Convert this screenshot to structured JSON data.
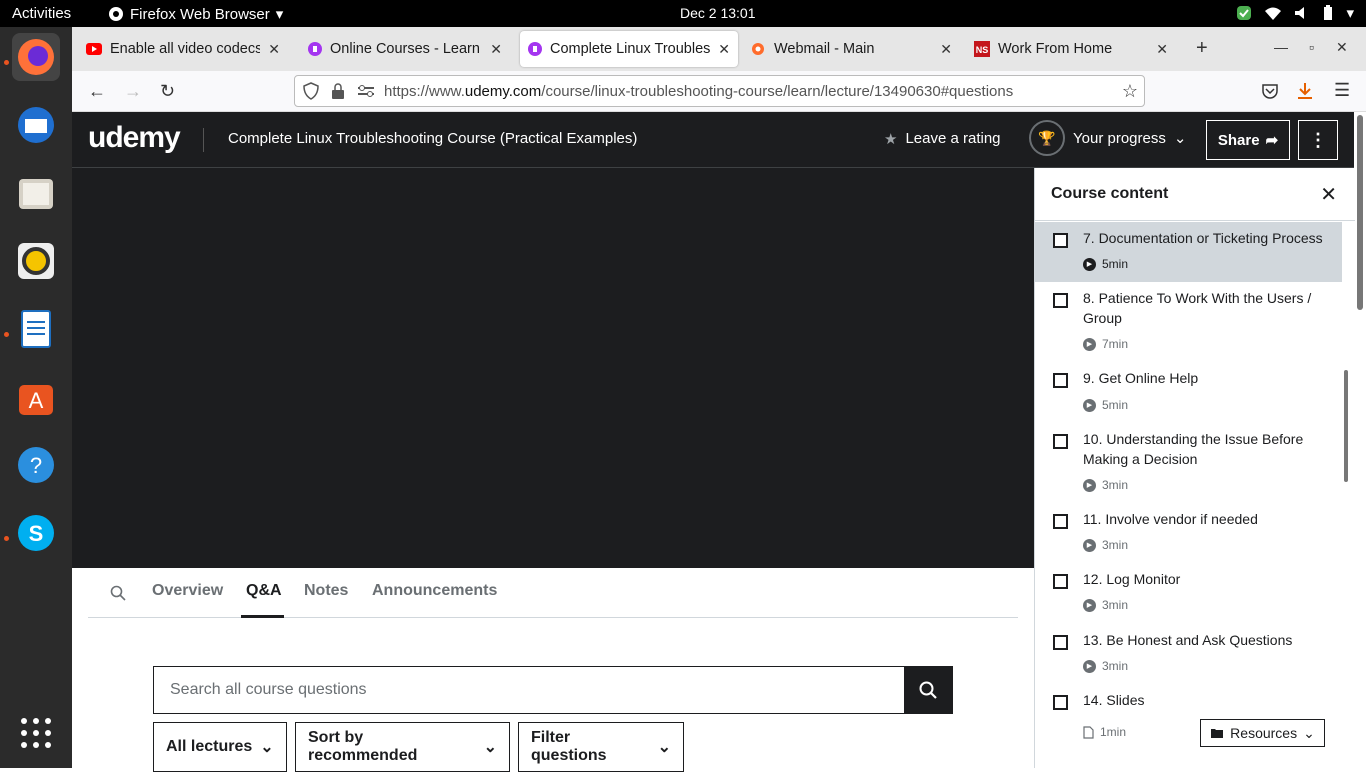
{
  "system": {
    "activities": "Activities",
    "app_name": "Firefox Web Browser",
    "clock": "Dec 2  13:01"
  },
  "tabs": [
    {
      "title": "Enable all video codecs o",
      "icon": "youtube-icon",
      "color": "#ff0000"
    },
    {
      "title": "Online Courses - Learn An",
      "icon": "udemy-icon",
      "color": "#a435f0"
    },
    {
      "title": "Complete Linux Troubleshoo",
      "icon": "udemy-icon",
      "color": "#a435f0"
    },
    {
      "title": "Webmail - Main",
      "icon": "cpanel-icon",
      "color": "#ff6c2c"
    },
    {
      "title": "Work From Home",
      "icon": "ns-icon",
      "color": "#c4161c"
    }
  ],
  "url": {
    "prefix": "https://www.",
    "domain": "udemy.com",
    "path": "/course/linux-troubleshooting-course/learn/lecture/13490630#questions"
  },
  "header": {
    "logo": "udemy",
    "course_title": "Complete Linux Troubleshooting Course (Practical Examples)",
    "rating": "Leave a rating",
    "progress": "Your progress",
    "share": "Share"
  },
  "subtabs": [
    "Overview",
    "Q&A",
    "Notes",
    "Announcements"
  ],
  "qa": {
    "search_placeholder": "Search all course questions",
    "filters": [
      "All lectures",
      "Sort by recommended",
      "Filter questions"
    ]
  },
  "panel": {
    "title": "Course content",
    "lectures": [
      {
        "title": "7. Documentation or Ticketing Process",
        "duration": "5min",
        "kind": "video"
      },
      {
        "title": "8. Patience To Work With the Users / Group",
        "duration": "7min",
        "kind": "video"
      },
      {
        "title": "9. Get Online Help",
        "duration": "5min",
        "kind": "video"
      },
      {
        "title": "10. Understanding the Issue Before Making a Decision",
        "duration": "3min",
        "kind": "video"
      },
      {
        "title": "11. Involve vendor if needed",
        "duration": "3min",
        "kind": "video"
      },
      {
        "title": "12. Log Monitor",
        "duration": "3min",
        "kind": "video"
      },
      {
        "title": "13. Be Honest and Ask Questions",
        "duration": "3min",
        "kind": "video"
      },
      {
        "title": "14. Slides",
        "duration": "1min",
        "kind": "file"
      }
    ],
    "resources": "Resources"
  }
}
